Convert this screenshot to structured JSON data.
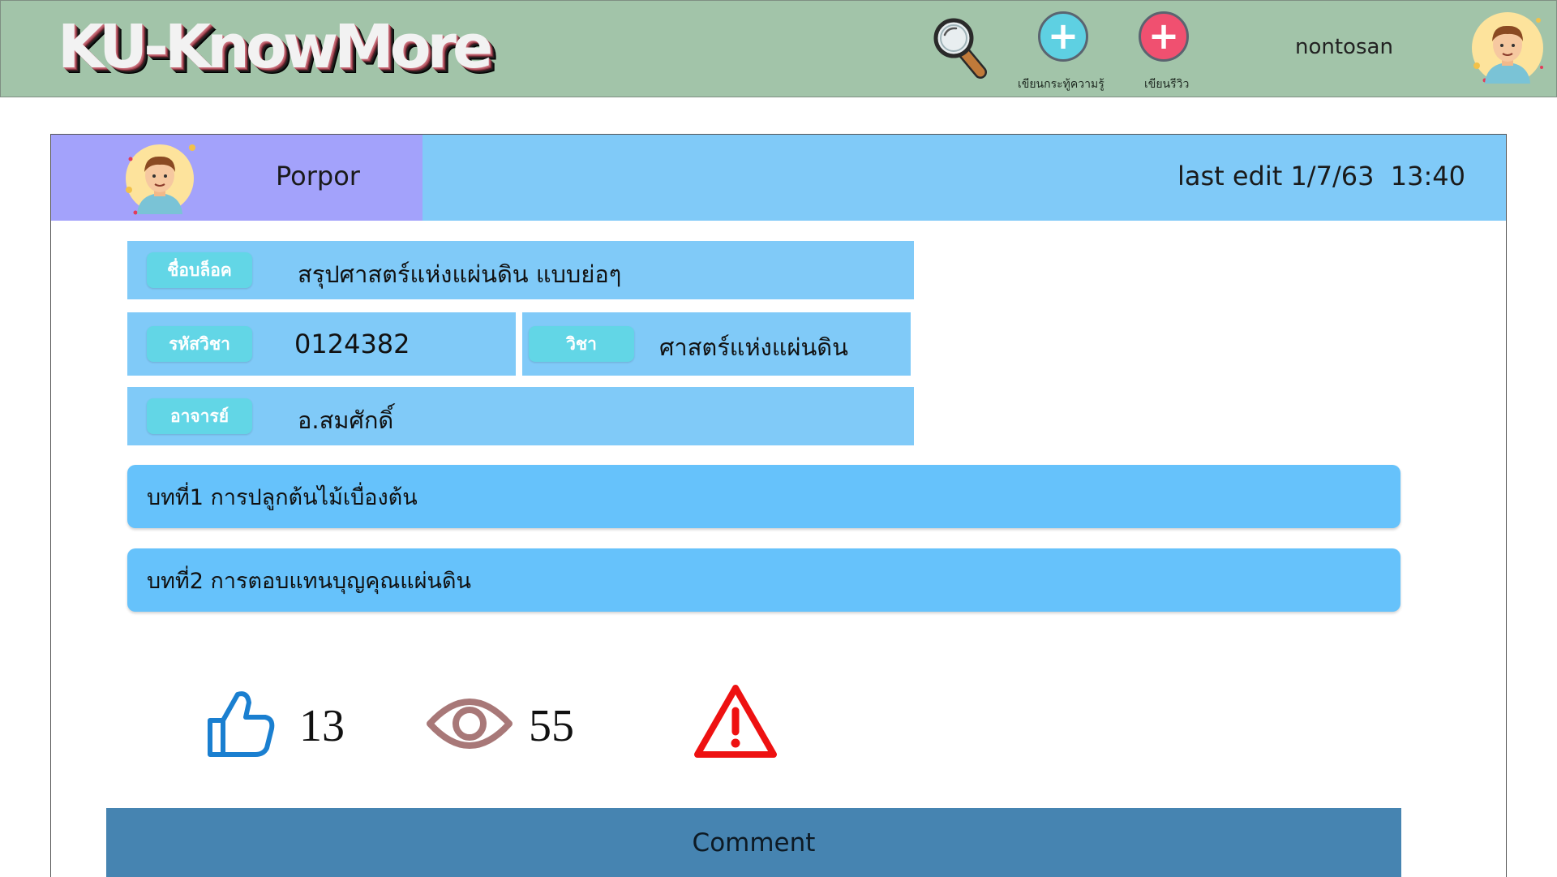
{
  "header": {
    "logo": "KU-KnowMore",
    "write_knowledge_label": "เขียนกระทู้ความรู้",
    "write_review_label": "เขียนรีวิว",
    "username": "nontosan"
  },
  "post": {
    "author": "Porpor",
    "last_edit": "last edit 1/7/63  13:40",
    "block_name_tag": "ชื่อบล็อค",
    "block_name": "สรุปศาสตร์แห่งแผ่นดิน แบบย่อๆ",
    "course_code_tag": "รหัสวิชา",
    "course_code": "0124382",
    "course_tag": "วิชา",
    "course_name": "ศาสตร์แห่งแผ่นดิน",
    "teacher_tag": "อาจารย์",
    "teacher": "อ.สมศักดิ์",
    "chapters": [
      "บทที่1 การปลูกต้นไม้เบื่องต้น",
      "บทที่2 การตอบแทนบุญคุณแผ่นดิน"
    ],
    "likes": "13",
    "views": "55",
    "comment_label": "Comment"
  },
  "colors": {
    "topbar": "#a2c4a9",
    "author_box": "#a3a2fb",
    "header_blue": "#80caf8",
    "chapter_blue": "#66c2fb",
    "tag_cyan": "#62d6e6",
    "comment_bar": "#4684b1",
    "like_blue": "#1a7fd0",
    "view_brown": "#a87878",
    "report_red": "#ee1111"
  },
  "icons": {
    "search": "magnifier-icon",
    "add_knowledge": "plus-circle-icon",
    "add_review": "plus-circle-icon",
    "avatar": "user-avatar-icon",
    "like": "thumbs-up-icon",
    "views": "eye-icon",
    "report": "warning-icon"
  }
}
